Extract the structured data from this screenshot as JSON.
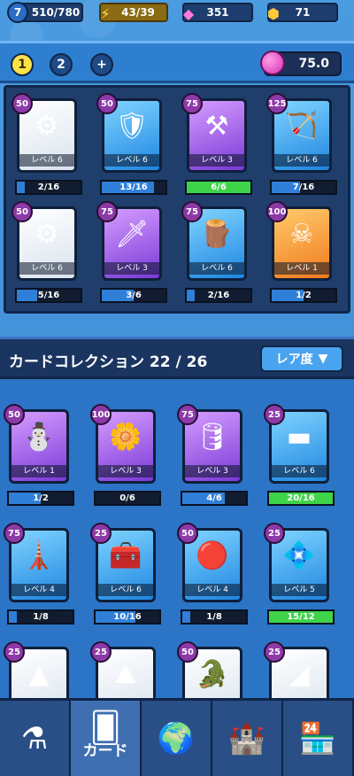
{
  "topbar": {
    "level": "7",
    "hp": "510/780",
    "bolt": "43/39",
    "gems": "351",
    "coins": "71",
    "icons": {
      "bolt": "lightning-icon",
      "gems": "gem-icon",
      "coins": "coin-icon"
    }
  },
  "tabs": {
    "tab1": "1",
    "tab2": "2",
    "add": "+"
  },
  "energy": "75.0",
  "deck": [
    {
      "cost": "50",
      "level": "レベル 6",
      "progress": "2/16",
      "fill": 0.125,
      "rarity": "white",
      "art": "⚙"
    },
    {
      "cost": "50",
      "level": "レベル 6",
      "progress": "13/16",
      "fill": 0.8125,
      "rarity": "blue",
      "art": "🛡"
    },
    {
      "cost": "75",
      "level": "レベル 3",
      "progress": "6/6",
      "fill": 1.0,
      "rarity": "purple",
      "art": "⚒"
    },
    {
      "cost": "125",
      "level": "レベル 6",
      "progress": "7/16",
      "fill": 0.44,
      "rarity": "blue",
      "art": "🏹"
    },
    {
      "cost": "50",
      "level": "レベル 6",
      "progress": "5/16",
      "fill": 0.3125,
      "rarity": "white",
      "art": "⚙"
    },
    {
      "cost": "75",
      "level": "レベル 3",
      "progress": "3/6",
      "fill": 0.5,
      "rarity": "purple",
      "art": "🗡"
    },
    {
      "cost": "75",
      "level": "レベル 6",
      "progress": "2/16",
      "fill": 0.125,
      "rarity": "blue",
      "art": "🪵"
    },
    {
      "cost": "100",
      "level": "レベル 1",
      "progress": "1/2",
      "fill": 0.5,
      "rarity": "gold",
      "art": "☠"
    }
  ],
  "collection_header": {
    "title": "カードコレクション 22 / 26",
    "sort_label": "レア度",
    "sort_icon": "triangle-down-icon"
  },
  "collection": [
    {
      "cost": "50",
      "level": "レベル 1",
      "progress": "1/2",
      "fill": 0.5,
      "rarity": "purple",
      "art": "⛄"
    },
    {
      "cost": "100",
      "level": "レベル 3",
      "progress": "0/6",
      "fill": 0.0,
      "rarity": "purple",
      "art": "🌼"
    },
    {
      "cost": "75",
      "level": "レベル 3",
      "progress": "4/6",
      "fill": 0.66,
      "rarity": "purple",
      "art": "🛢"
    },
    {
      "cost": "25",
      "level": "レベル 6",
      "progress": "20/16",
      "fill": 1.0,
      "rarity": "blue",
      "art": "▬"
    },
    {
      "cost": "75",
      "level": "レベル 4",
      "progress": "1/8",
      "fill": 0.125,
      "rarity": "blue",
      "art": "🗼"
    },
    {
      "cost": "25",
      "level": "レベル 6",
      "progress": "10/16",
      "fill": 0.625,
      "rarity": "blue",
      "art": "🧰"
    },
    {
      "cost": "50",
      "level": "レベル 4",
      "progress": "1/8",
      "fill": 0.125,
      "rarity": "blue",
      "art": "🔴"
    },
    {
      "cost": "25",
      "level": "レベル 5",
      "progress": "15/12",
      "fill": 1.0,
      "rarity": "blue",
      "art": "💠"
    },
    {
      "cost": "25",
      "level": "",
      "progress": "",
      "fill": 0.0,
      "rarity": "white",
      "art": "▲"
    },
    {
      "cost": "25",
      "level": "",
      "progress": "",
      "fill": 0.0,
      "rarity": "white",
      "art": "⛰"
    },
    {
      "cost": "50",
      "level": "",
      "progress": "",
      "fill": 0.0,
      "rarity": "white",
      "art": "🐊"
    },
    {
      "cost": "25",
      "level": "",
      "progress": "",
      "fill": 0.0,
      "rarity": "white",
      "art": "◢"
    }
  ],
  "nav": [
    {
      "icon": "flask-icon",
      "glyph": "⚗",
      "label": ""
    },
    {
      "icon": "cards-icon",
      "glyph": "🂠",
      "label": "カード"
    },
    {
      "icon": "globe-icon",
      "glyph": "🌍",
      "label": ""
    },
    {
      "icon": "castle-icon",
      "glyph": "🏰",
      "label": ""
    },
    {
      "icon": "shop-icon",
      "glyph": "🏪",
      "label": ""
    }
  ]
}
